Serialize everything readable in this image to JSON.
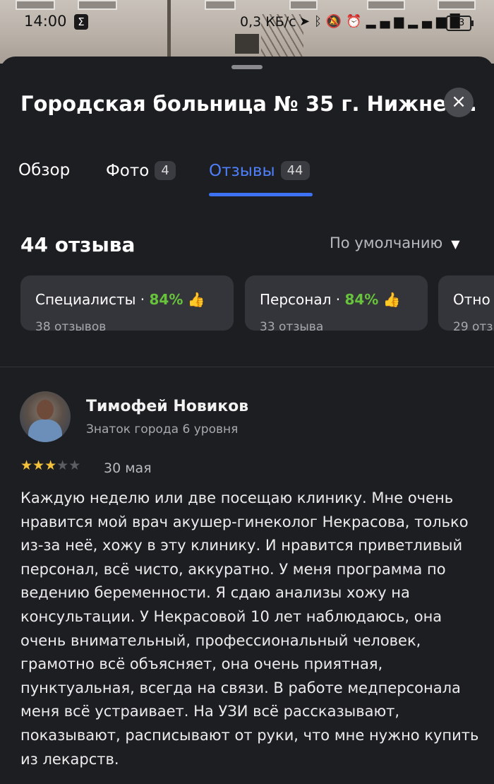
{
  "status_bar": {
    "time": "14:00",
    "speed": "0,3 КБ/с",
    "battery": "33",
    "icons": [
      "sigma-icon",
      "location-icon",
      "bluetooth-icon",
      "mute-icon",
      "alarm-icon",
      "signal-4g-icon",
      "signal-icon"
    ]
  },
  "header": {
    "title": "Городская больница № 35 г. Нижне ...",
    "close_label": "×"
  },
  "tabs": [
    {
      "label": "Обзор",
      "badge": ""
    },
    {
      "label": "Фото",
      "badge": "4"
    },
    {
      "label": "Отзывы",
      "badge": "44",
      "active": true
    }
  ],
  "reviews_summary": {
    "count_label": "44 отзыва",
    "sort_label": "По умолчанию"
  },
  "categories": [
    {
      "name": "Специалисты",
      "percent": "84%",
      "count": "38 отзывов"
    },
    {
      "name": "Персонал",
      "percent": "84%",
      "count": "33 отзыва"
    },
    {
      "name": "Отно",
      "percent": "",
      "count": "29 отз"
    }
  ],
  "review": {
    "author": "Тимофей Новиков",
    "level": "Знаток города 6 уровня",
    "rating": 3,
    "rating_max": 5,
    "date": "30 мая",
    "text": "Каждую неделю или две посещаю клинику. Мне очень нравится мой врач акушер-гинеколог Некрасова, только из-за неё, хожу в эту клинику. И нравится приветливый персонал, всё чисто, аккуратно. У меня программа по ведению беременности. Я сдаю анализы хожу на консультации. У Некрасовой 10 лет наблюдаюсь, она очень внимательный, профессиональный человек, грамотно всё объясняет, она очень приятная, пунктуальная, всегда на связи. В работе медперсонала меня всё устраивает. На УЗИ всё рассказывают, показывают, расписывают от руки, что мне нужно купить из лекарств."
  },
  "colors": {
    "background": "#1d1e22",
    "card": "#34353a",
    "accent": "#3d72f5",
    "positive": "#67c23c",
    "star": "#f3c23a"
  }
}
